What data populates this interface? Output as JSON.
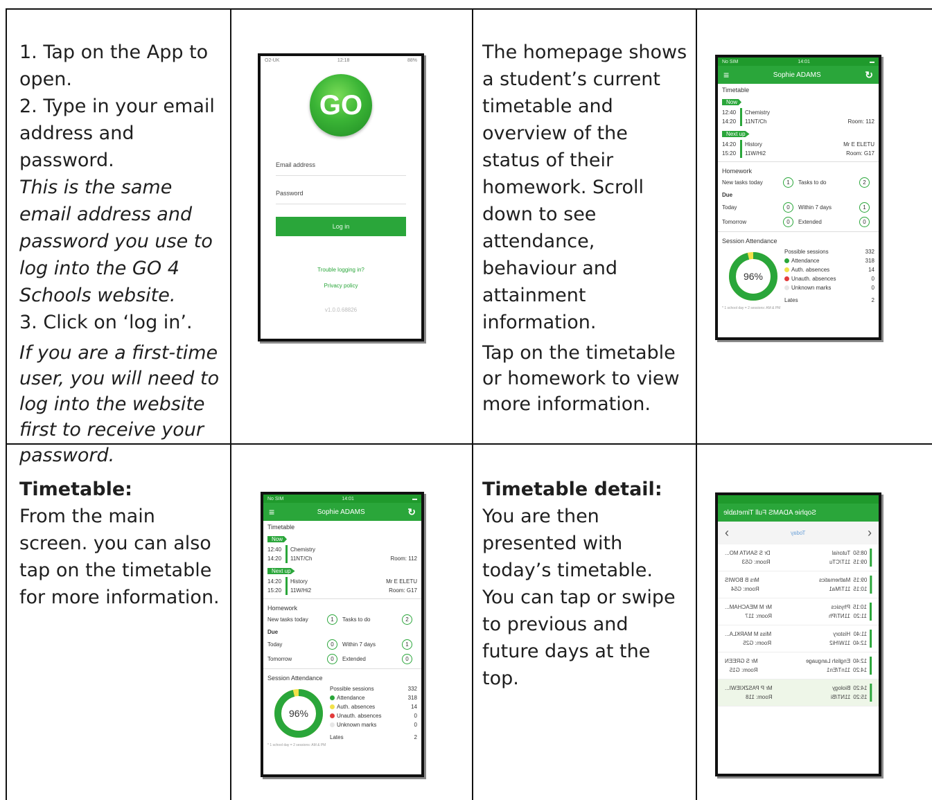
{
  "row1": {
    "col1": {
      "step1": "1. Tap on the App to open.",
      "step2": "2. Type in your email address and password.",
      "note1": "This is the same email address and password you use to log into the GO 4 Schools website.",
      "step3": "3. Click on ‘log in’.",
      "note2": "If you are a first-time user, you will need to log into the website first to receive your password."
    },
    "col3": {
      "p1": "The homepage shows a student’s current timetable and overview of the status of their homework. Scroll down to see attendance, behaviour and attainment information.",
      "p2": "Tap on the timetable or homework to view more information."
    }
  },
  "row2": {
    "col1": {
      "title": "Timetable:",
      "body": "From the main screen. you can also tap on the timetable for more information."
    },
    "col3": {
      "title": "Timetable detail:",
      "body": "You are then presented with today’s timetable. You can tap or swipe to previous and future days at the top."
    }
  },
  "login_phone": {
    "status_carrier": "O2-UK",
    "status_time": "12:18",
    "status_battery": "88%",
    "logo": "GO",
    "email_label": "Email address",
    "password_label": "Password",
    "login_button": "Log in",
    "trouble_link": "Trouble logging in?",
    "privacy_link": "Privacy policy",
    "version": "v1.0.0.68826"
  },
  "home_phone": {
    "status_carrier": "No SIM",
    "status_time": "14:01",
    "user": "Sophie ADAMS",
    "timetable_title": "Timetable",
    "now_label": "Now",
    "now_times": [
      "12:40",
      "14:20"
    ],
    "now_subject": "Chemistry",
    "now_group": "11NT/Ch",
    "now_room": "Room: 112",
    "next_label": "Next up",
    "next_times": [
      "14:20",
      "15:20"
    ],
    "next_subject": "History",
    "next_group": "11W/Hi2",
    "next_teacher": "Mr E ELETU",
    "next_room": "Room: G17",
    "homework_title": "Homework",
    "new_tasks_label": "New tasks today",
    "new_tasks": "1",
    "tasks_todo_label": "Tasks to do",
    "tasks_todo": "2",
    "due_label": "Due",
    "today_label": "Today",
    "today": "0",
    "within7_label": "Within 7 days",
    "within7": "1",
    "tomorrow_label": "Tomorrow",
    "tomorrow": "0",
    "extended_label": "Extended",
    "extended": "0",
    "attendance_title": "Session Attendance",
    "attendance_pct": "96%",
    "possible_label": "Possible sessions",
    "possible": "332",
    "attendance_label": "Attendance",
    "attendance": "318",
    "auth_label": "Auth. absences",
    "auth": "14",
    "unauth_label": "Unauth. absences",
    "unauth": "0",
    "unknown_label": "Unknown marks",
    "unknown": "0",
    "lates_label": "Lates",
    "lates": "2",
    "footnote": "* 1 school day = 2 sessions: AM & PM",
    "colors": {
      "green": "#2aa63a",
      "yellow": "#f2e14a",
      "red": "#e23b3b",
      "grey": "#e6e6e6"
    }
  },
  "detail_phone": {
    "header": "Sophie ADAMS Full Timetable",
    "day": "Today",
    "rows": [
      {
        "times": [
          "08:50",
          "09:15"
        ],
        "subject": "Tutorial",
        "group": "11T/CTu",
        "teacher": "Dr S SANTA MO...",
        "room": "Room: G53",
        "current": false
      },
      {
        "times": [
          "09:15",
          "10:15"
        ],
        "subject": "Mathematics",
        "group": "11T/Ma1",
        "teacher": "Mrs B BOWIS",
        "room": "Room: G54",
        "current": false
      },
      {
        "times": [
          "10:15",
          "11:20"
        ],
        "subject": "Physics",
        "group": "11NT/Ph",
        "teacher": "Mr M MEACHAM...",
        "room": "Room: 117",
        "current": false
      },
      {
        "times": [
          "11:40",
          "12:40"
        ],
        "subject": "History",
        "group": "11W/Hi2",
        "teacher": "Miss M MARKLA...",
        "room": "Room: G25",
        "current": false
      },
      {
        "times": [
          "12:40",
          "14:20"
        ],
        "subject": "English Language",
        "group": "11nT/En1",
        "teacher": "Mr S GREEN",
        "room": "Room: G15",
        "current": false
      },
      {
        "times": [
          "14:20",
          "15:20"
        ],
        "subject": "Biology",
        "group": "11NT/Bi",
        "teacher": "Mr P PASZKIEWI...",
        "room": "Room: 118",
        "current": true
      }
    ]
  }
}
